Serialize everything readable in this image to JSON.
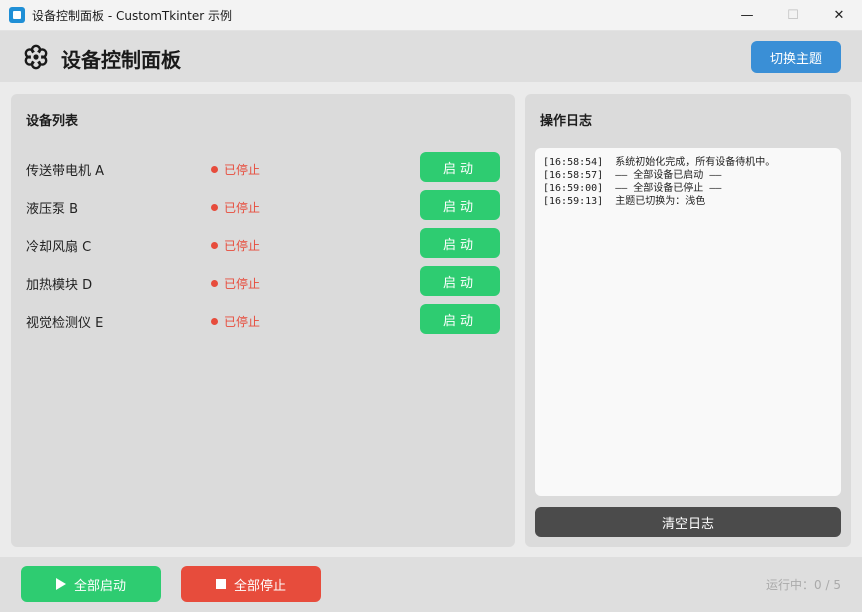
{
  "window": {
    "title": "设备控制面板 - CustomTkinter 示例",
    "minimize": "—",
    "maximize": "☐",
    "close": "✕"
  },
  "header": {
    "title": "设备控制面板",
    "theme_button": "切换主题"
  },
  "devices": {
    "title": "设备列表",
    "items": [
      {
        "name": "传送带电机 A",
        "status": "已停止",
        "action": "启动"
      },
      {
        "name": "液压泵 B",
        "status": "已停止",
        "action": "启动"
      },
      {
        "name": "冷却风扇 C",
        "status": "已停止",
        "action": "启动"
      },
      {
        "name": "加热模块 D",
        "status": "已停止",
        "action": "启动"
      },
      {
        "name": "视觉检测仪 E",
        "status": "已停止",
        "action": "启动"
      }
    ]
  },
  "log": {
    "title": "操作日志",
    "entries": [
      "[16:58:54]  系统初始化完成，所有设备待机中。",
      "[16:58:57]  —— 全部设备已启动 ——",
      "[16:59:00]  —— 全部设备已停止 ——",
      "[16:59:13]  主题已切换为：浅色"
    ],
    "clear_button": "清空日志"
  },
  "footer": {
    "start_all": "全部启动",
    "stop_all": "全部停止",
    "running_count": "运行中：0 / 5"
  },
  "colors": {
    "accent_blue": "#3a8fd6",
    "start_green": "#2ecc71",
    "stop_red": "#e74c3c",
    "dark_button": "#4b4b4b"
  }
}
